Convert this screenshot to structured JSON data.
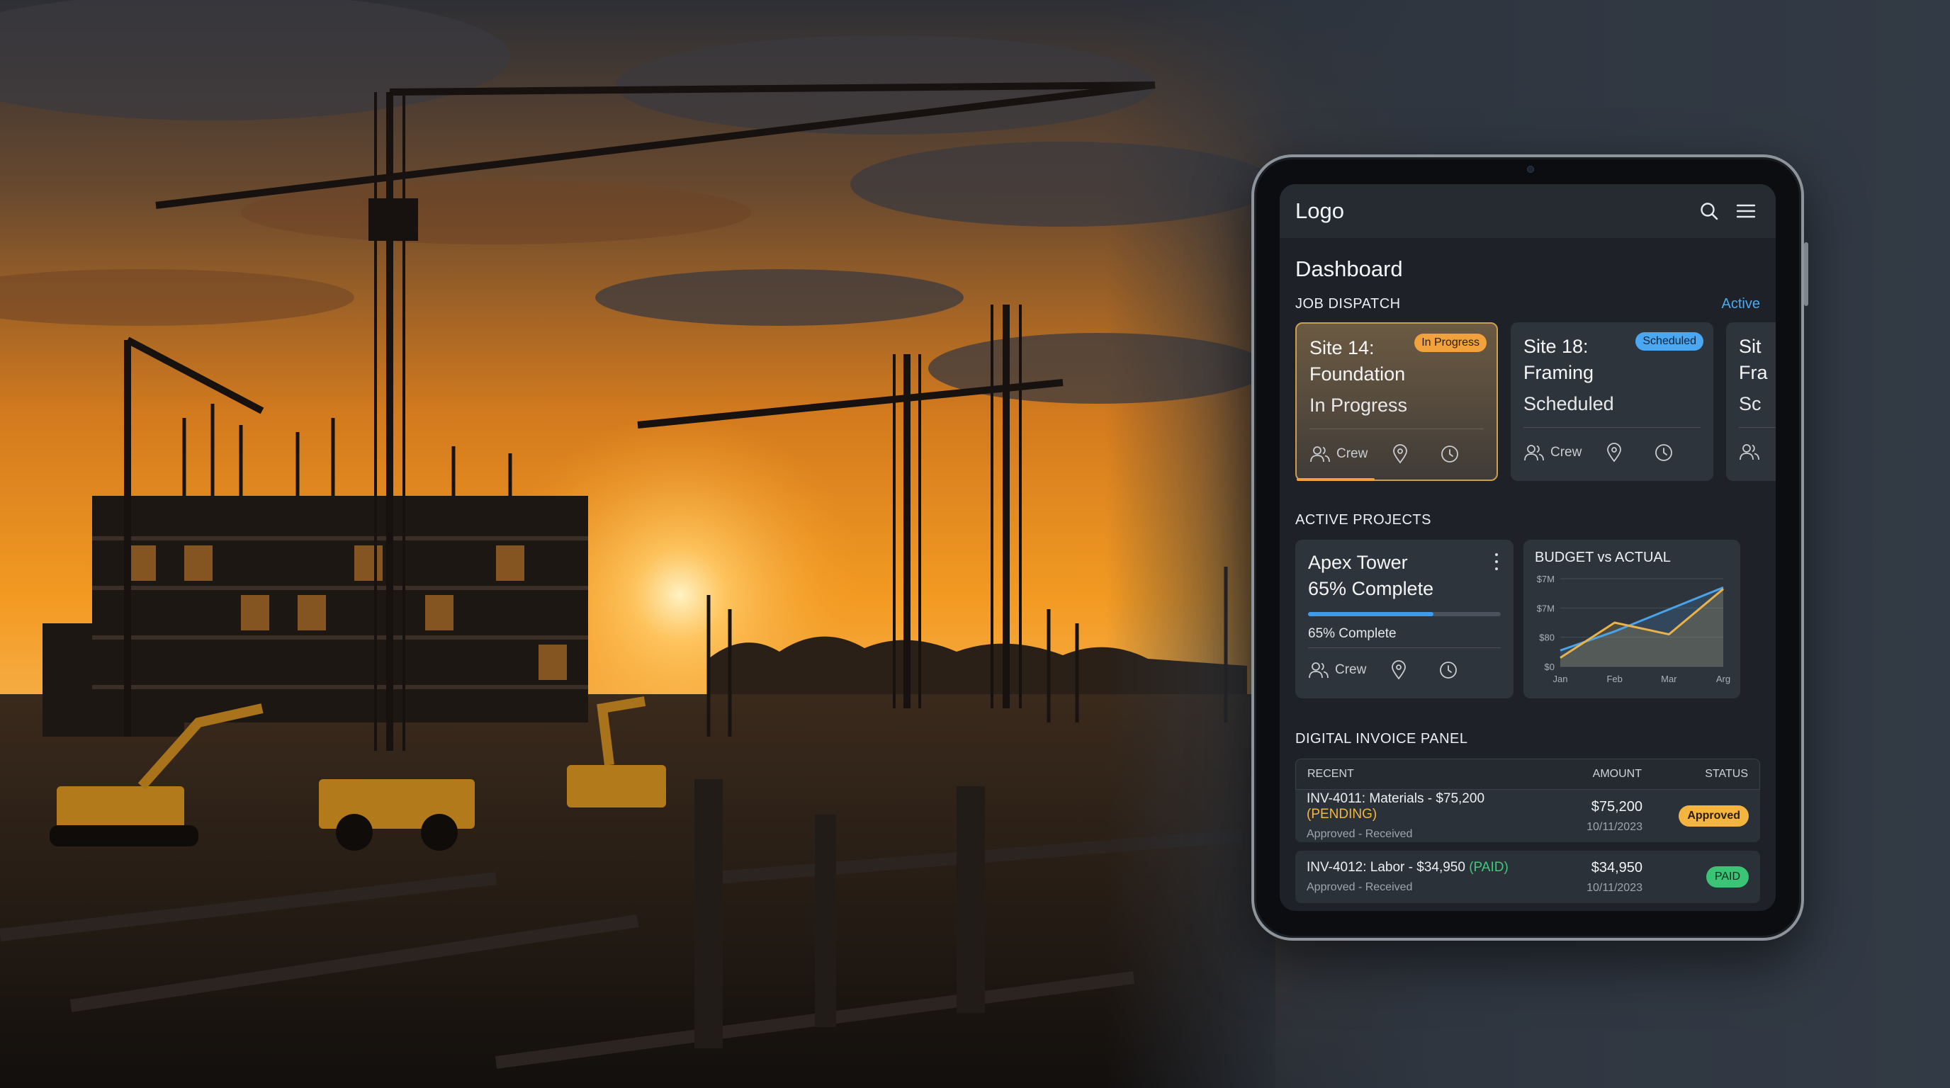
{
  "header": {
    "logo": "Logo"
  },
  "page": {
    "title": "Dashboard"
  },
  "job_dispatch": {
    "label": "JOB DISPATCH",
    "filter": "Active",
    "cards": [
      {
        "title": "Site 14: Foundation",
        "badge": "In Progress",
        "status": "In Progress",
        "crew": "Crew"
      },
      {
        "title": "Site 18: Framing",
        "badge": "Scheduled",
        "status": "Scheduled",
        "crew": "Crew"
      },
      {
        "title": "Sit Fra",
        "status": "Sc"
      }
    ]
  },
  "active_projects": {
    "label": "ACTIVE PROJECTS",
    "project": {
      "name": "Apex Tower",
      "subtitle": "65% Complete",
      "progress": 0.65,
      "progress_label": "65% Complete",
      "crew": "Crew"
    },
    "chart": {
      "title": "BUDGET vs ACTUAL",
      "chart_data": {
        "type": "line",
        "title": "BUDGET vs ACTUAL",
        "categories": [
          "Jan",
          "Feb",
          "Mar",
          "Arg"
        ],
        "y_tick_labels": [
          "$0",
          "$80",
          "$7M",
          "$7M"
        ],
        "series": [
          {
            "values": [
              0.55,
              1.2,
              1.95,
              2.7
            ]
          },
          {
            "values": [
              0.3,
              1.5,
              1.1,
              2.65
            ]
          }
        ],
        "colors": [
          "#4aa3e8",
          "#e9b24a"
        ],
        "area_fill": true,
        "grid": true
      }
    }
  },
  "invoices": {
    "label": "DIGITAL INVOICE PANEL",
    "columns": [
      "RECENT",
      "AMOUNT",
      "STATUS"
    ],
    "rows": [
      {
        "text": "INV-4011: Materials - $75,200",
        "tag": "(PENDING)",
        "sub": "Approved - Received",
        "amount": "$75,200",
        "date": "10/11/2023",
        "status": "Approved"
      },
      {
        "text": "INV-4012: Labor - $34,950",
        "tag": "(PAID)",
        "sub": "Approved - Received",
        "amount": "$34,950",
        "date": "10/11/2023",
        "status": "PAID"
      }
    ]
  },
  "colors": {
    "accent_blue": "#4ea8f0",
    "accent_orange": "#f1a23c",
    "success_green": "#3cc476",
    "screen_bg": "#1e2228",
    "card_bg": "#2e343c"
  }
}
